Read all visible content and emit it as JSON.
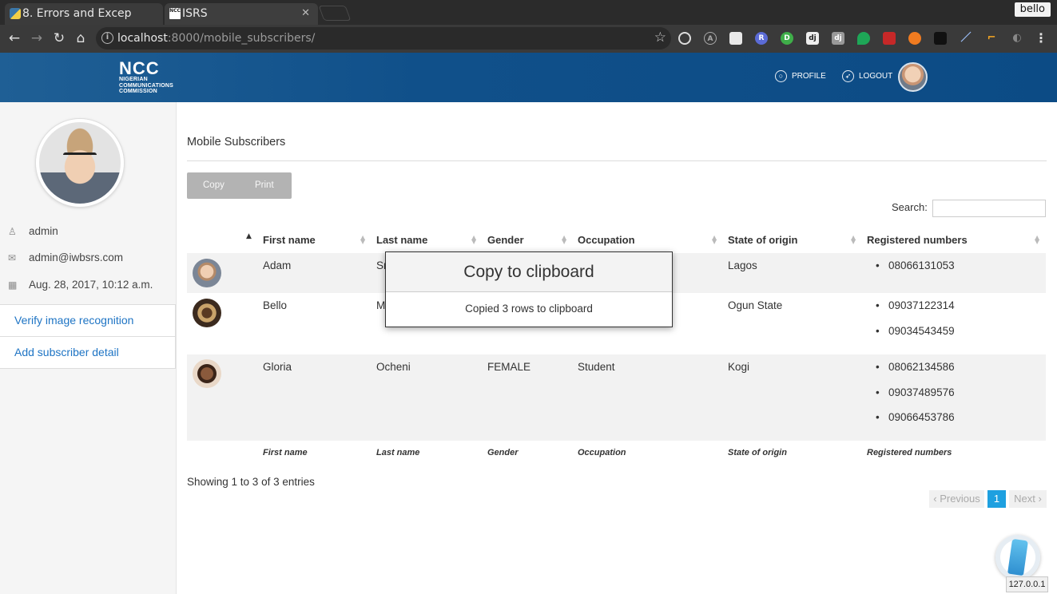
{
  "browser": {
    "tabs": [
      {
        "title": "8. Errors and Excep",
        "icon": "python-icon"
      },
      {
        "title": "ISRS",
        "icon": "ncc-favicon"
      }
    ],
    "profile_name": "bello",
    "url_host": "localhost",
    "url_rest": ":8000/mobile_subscribers/"
  },
  "header": {
    "logo_big": "NCC",
    "logo_lines": [
      "NIGERIAN",
      "COMMUNICATIONS",
      "COMMISSION"
    ],
    "profile_label": "PROFILE",
    "logout_label": "LOGOUT"
  },
  "sidebar": {
    "username": "admin",
    "email": "admin@iwbsrs.com",
    "joined": "Aug. 28, 2017, 10:12 a.m.",
    "links": [
      {
        "label": "Verify image recognition"
      },
      {
        "label": "Add subscriber detail"
      }
    ]
  },
  "main": {
    "title": "Mobile Subscribers",
    "buttons": {
      "copy": "Copy",
      "print": "Print"
    },
    "search_label": "Search:",
    "columns": [
      "First name",
      "Last name",
      "Gender",
      "Occupation",
      "State of origin",
      "Registered numbers"
    ],
    "rows": [
      {
        "first": "Adam",
        "last": "Sr",
        "gender": "",
        "occupation": "",
        "state": "Lagos",
        "numbers": [
          "08066131053"
        ]
      },
      {
        "first": "Bello",
        "last": "M",
        "gender": "",
        "occupation": "",
        "state": "Ogun State",
        "numbers": [
          "09037122314",
          "09034543459"
        ]
      },
      {
        "first": "Gloria",
        "last": "Ocheni",
        "gender": "FEMALE",
        "occupation": "Student",
        "state": "Kogi",
        "numbers": [
          "08062134586",
          "09037489576",
          "09066453786"
        ]
      }
    ],
    "info": "Showing 1 to 3 of 3 entries",
    "pagination": {
      "previous": "Previous",
      "current": "1",
      "next": "Next"
    }
  },
  "modal": {
    "title": "Copy to clipboard",
    "message": "Copied 3 rows to clipboard"
  },
  "status_bubble": "127.0.0.1",
  "colors": {
    "header": "#0c4b85",
    "link": "#1e74c4",
    "page_active": "#1ea0e0"
  }
}
